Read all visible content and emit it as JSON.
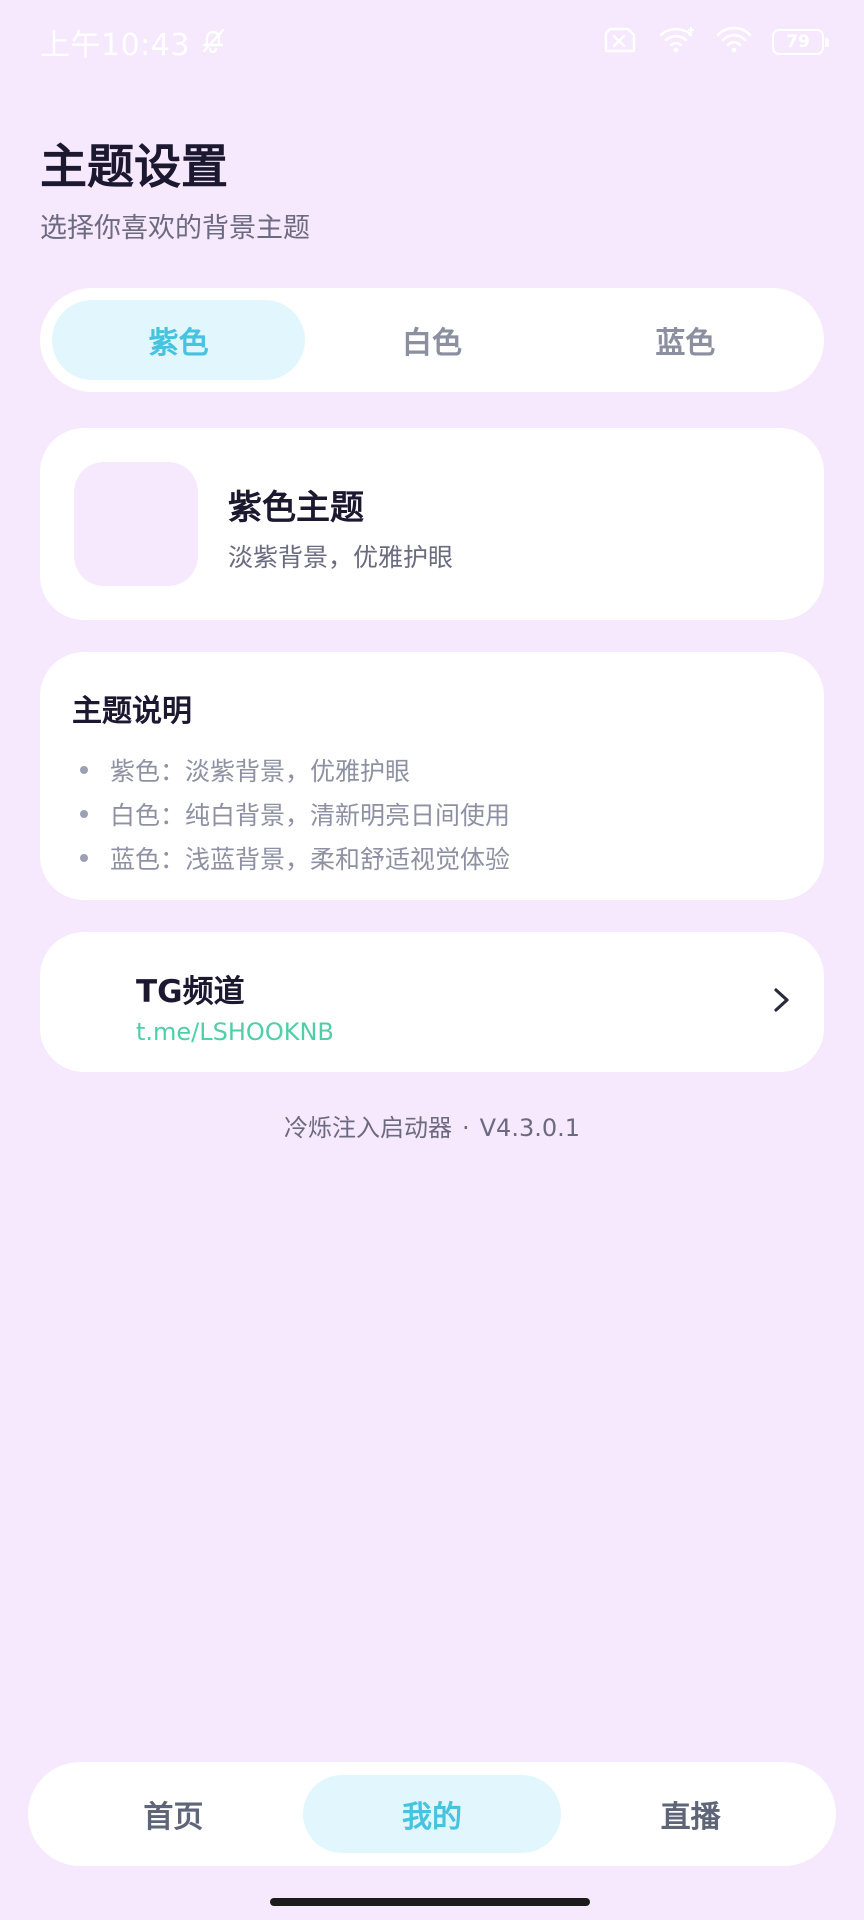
{
  "status_bar": {
    "time": "上午10:43",
    "battery": "79",
    "icons": [
      "bell-off-icon",
      "sim-off-icon",
      "wifi-icon",
      "wifi-icon",
      "battery-icon"
    ]
  },
  "header": {
    "title": "主题设置",
    "subtitle": "选择你喜欢的背景主题"
  },
  "theme_tabs": [
    {
      "label": "紫色",
      "active": true
    },
    {
      "label": "白色",
      "active": false
    },
    {
      "label": "蓝色",
      "active": false
    }
  ],
  "current_theme": {
    "name": "紫色主题",
    "description": "淡紫背景，优雅护眼",
    "swatch_color": "#f6e8fd"
  },
  "info": {
    "title": "主题说明",
    "items": [
      "紫色：淡紫背景，优雅护眼",
      "白色：纯白背景，清新明亮日间使用",
      "蓝色：浅蓝背景，柔和舒适视觉体验"
    ]
  },
  "tg": {
    "title": "TG频道",
    "link": "t.me/LSHOOKNB"
  },
  "footer": {
    "app_name": "冷烁注入启动器",
    "separator": "·",
    "version": "V4.3.0.1"
  },
  "bottom_nav": [
    {
      "label": "首页",
      "active": false
    },
    {
      "label": "我的",
      "active": true
    },
    {
      "label": "直播",
      "active": false
    }
  ],
  "colors": {
    "background": "#f6e8fd",
    "accent": "#45c3df",
    "accent_bg": "#e2f6fd",
    "link": "#4ecfa6"
  }
}
